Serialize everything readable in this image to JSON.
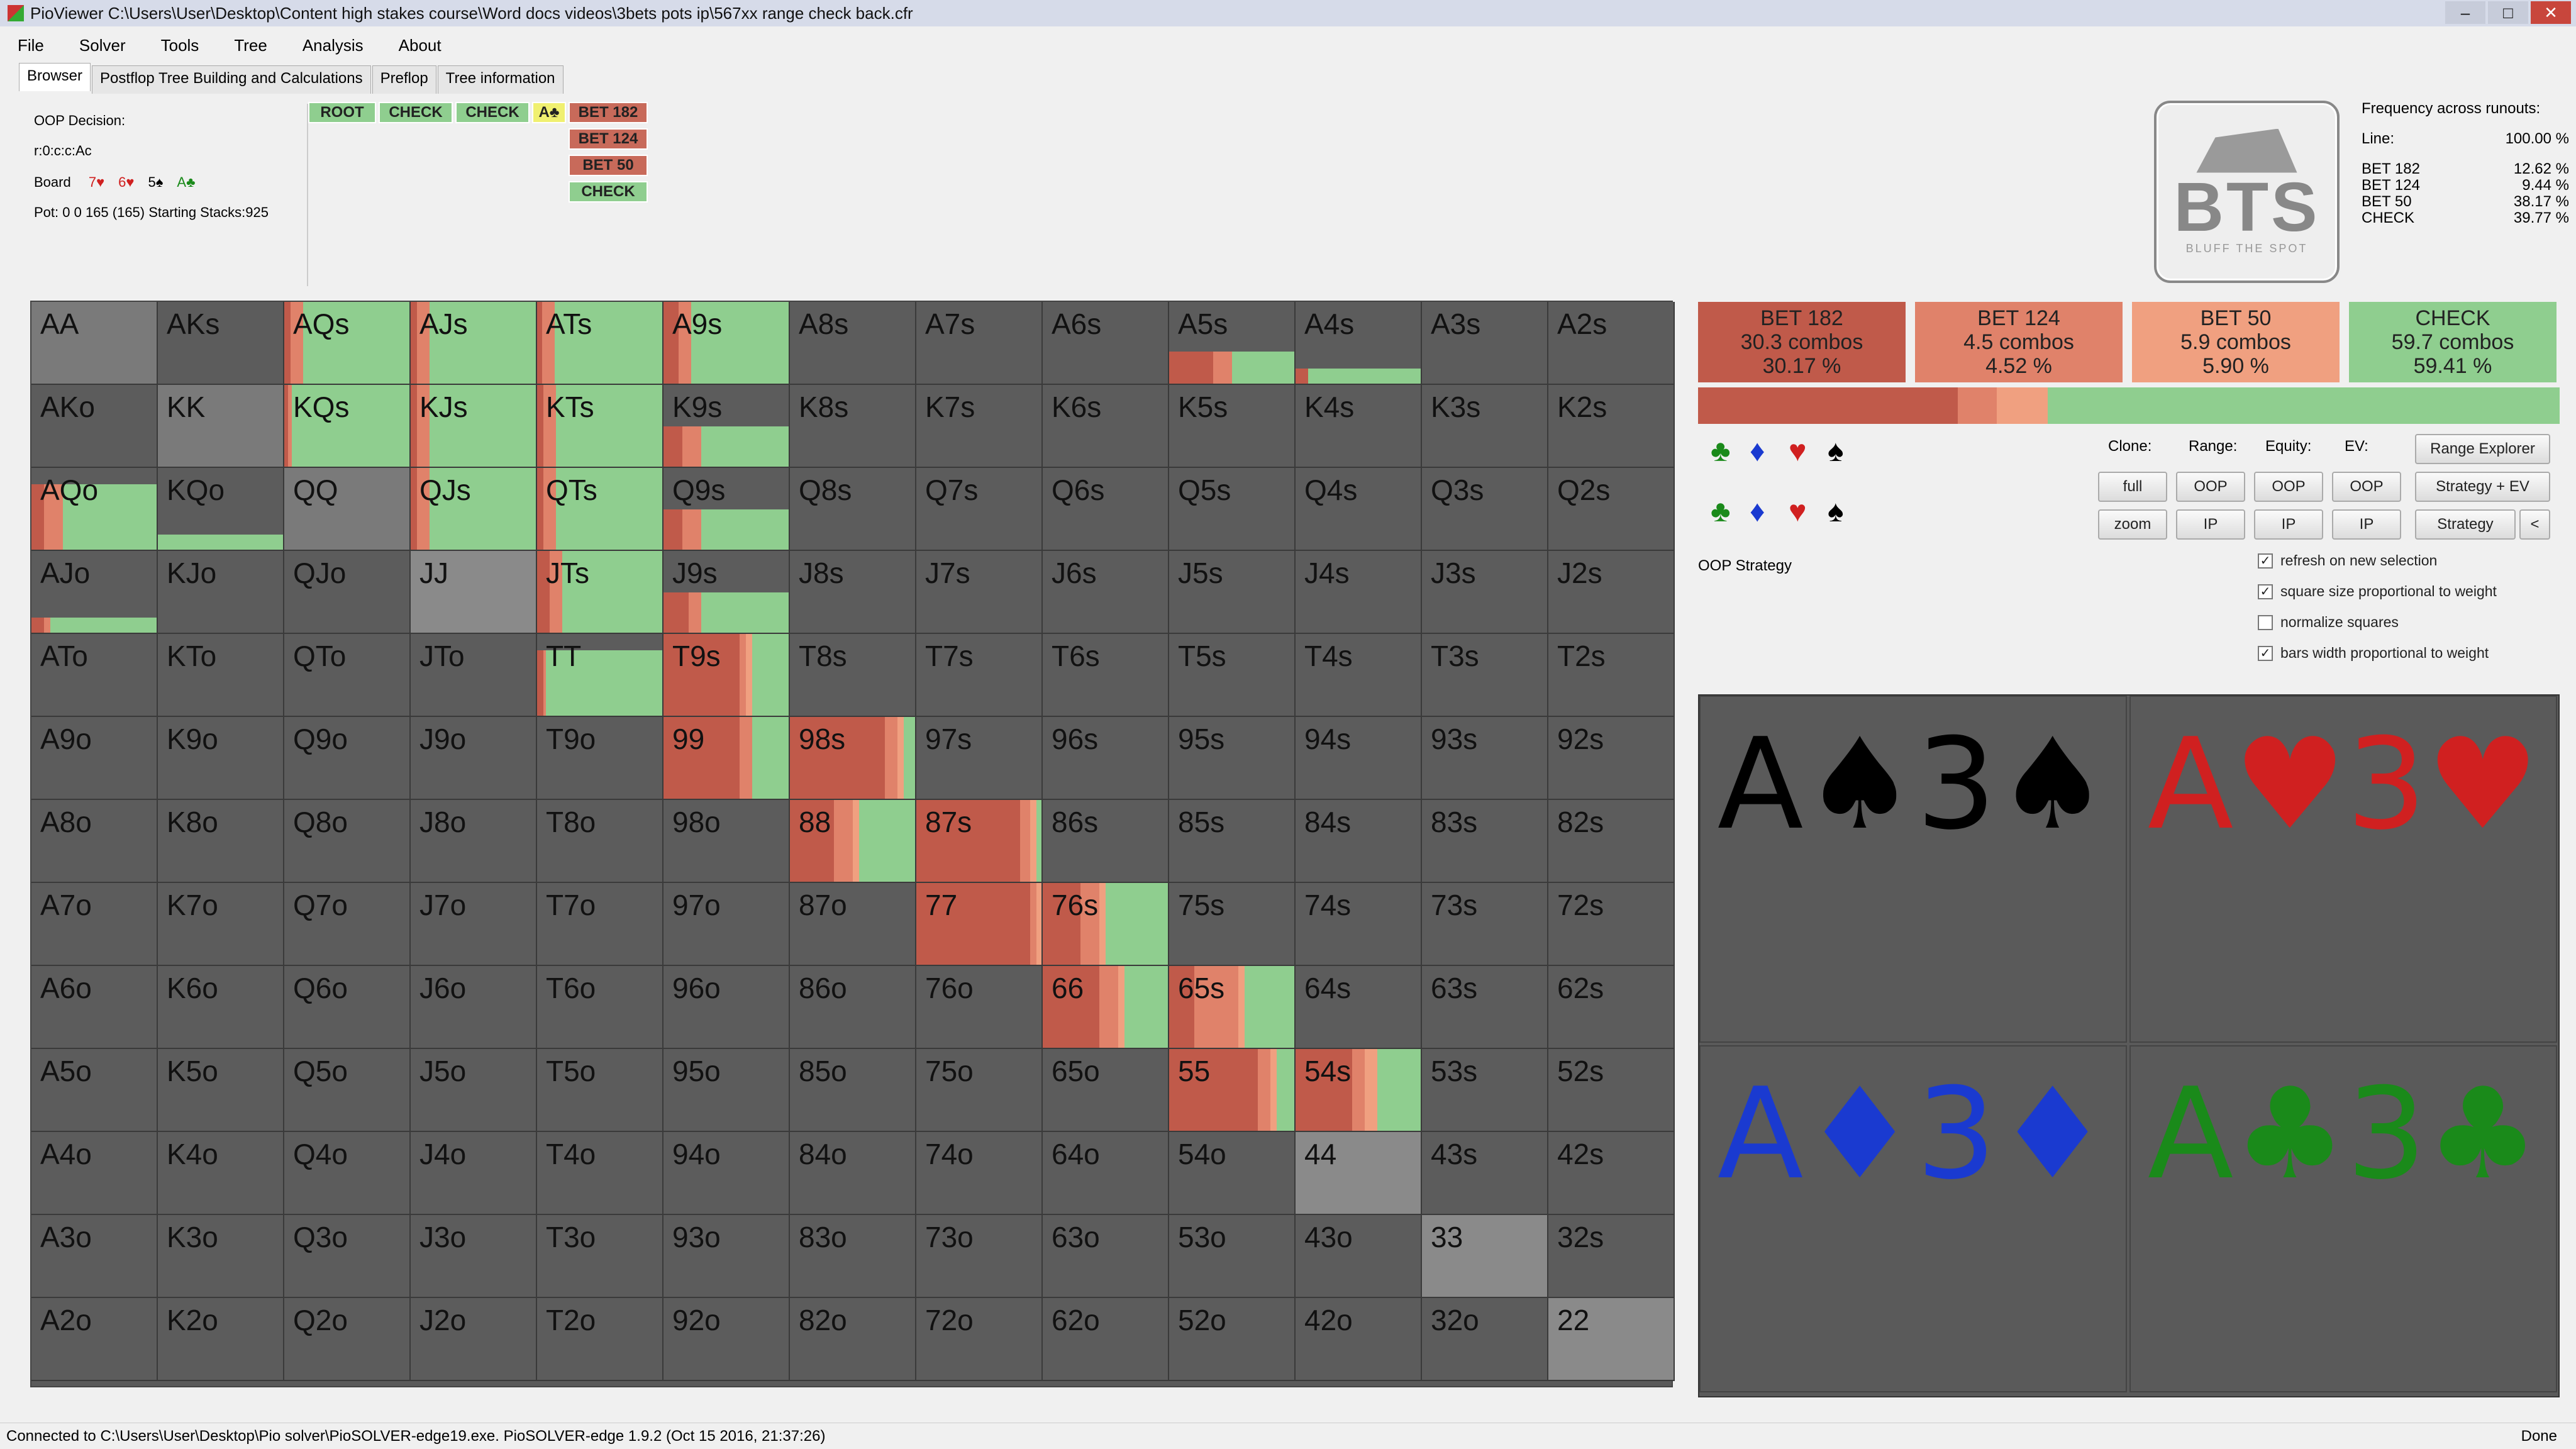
{
  "window": {
    "title": "PioViewer C:\\Users\\User\\Desktop\\Content high stakes course\\Word docs videos\\3bets pots ip\\567xx range check back.cfr"
  },
  "menu": [
    "File",
    "Solver",
    "Tools",
    "Tree",
    "Analysis",
    "About"
  ],
  "tabs": [
    "Browser",
    "Postflop Tree Building and Calculations",
    "Preflop",
    "Tree information"
  ],
  "info": {
    "decision": "OOP Decision:",
    "line": "r:0:c:c:Ac",
    "board_label": "Board",
    "board_cards": [
      {
        "text": "7♥",
        "color": "redc"
      },
      {
        "text": "6♥",
        "color": "redc"
      },
      {
        "text": "5♠",
        "color": "blkc"
      },
      {
        "text": "A♣",
        "color": "grnc"
      }
    ],
    "pot": "Pot: 0 0 165 (165) Starting Stacks:925"
  },
  "crumbs": {
    "row": [
      {
        "label": "ROOT",
        "style": "green"
      },
      {
        "label": "CHECK",
        "style": "green"
      },
      {
        "label": "CHECK",
        "style": "green"
      },
      {
        "label": "A♣",
        "style": "yellow"
      },
      {
        "label": "BET 182",
        "style": "red"
      }
    ],
    "column": [
      {
        "label": "BET 124",
        "style": "red"
      },
      {
        "label": "BET 50",
        "style": "red"
      },
      {
        "label": "CHECK",
        "style": "green"
      }
    ]
  },
  "logo": {
    "text": "BTS",
    "tagline": "BLUFF THE SPOT"
  },
  "freq": {
    "title": "Frequency across runouts:",
    "line_label": "Line:",
    "line_value": "100.00 %",
    "rows": [
      {
        "label": "BET 182",
        "value": "12.62 %"
      },
      {
        "label": "BET 124",
        "value": "9.44 %"
      },
      {
        "label": "BET 50",
        "value": "38.17 %"
      },
      {
        "label": "CHECK",
        "value": "39.77 %"
      }
    ]
  },
  "actions": [
    {
      "name": "BET 182",
      "combos": "30.3 combos",
      "pct": "30.17 %",
      "color": "#c05a4a"
    },
    {
      "name": "BET 124",
      "combos": "4.5 combos",
      "pct": "4.52 %",
      "color": "#e0826a"
    },
    {
      "name": "BET 50",
      "combos": "5.9 combos",
      "pct": "5.90 %",
      "color": "#f0a080"
    },
    {
      "name": "CHECK",
      "combos": "59.7 combos",
      "pct": "59.41 %",
      "color": "#8fce8f"
    }
  ],
  "action_fractions": [
    0.3017,
    0.0452,
    0.059,
    0.5941
  ],
  "controls": {
    "headers": [
      "Clone:",
      "Range:",
      "Equity:",
      "EV:"
    ],
    "buttons_row1": [
      "full",
      "OOP",
      "OOP",
      "OOP"
    ],
    "buttons_row2": [
      "zoom",
      "IP",
      "IP",
      "IP"
    ],
    "range_explorer": "Range Explorer",
    "strategy_ev": "Strategy + EV",
    "strategy": "Strategy",
    "arrow": "<",
    "label": "OOP Strategy",
    "checkboxes": [
      {
        "label": "refresh on new selection",
        "checked": true
      },
      {
        "label": "square size proportional to weight",
        "checked": true
      },
      {
        "label": "normalize squares",
        "checked": false
      },
      {
        "label": "bars width proportional to weight",
        "checked": true
      }
    ],
    "suits_row1": [
      {
        "s": "♣",
        "c": "#1a8a1a"
      },
      {
        "s": "♦",
        "c": "#1a3ad0"
      },
      {
        "s": "♥",
        "c": "#d02020"
      },
      {
        "s": "♠",
        "c": "#000"
      }
    ],
    "suits_row2": [
      {
        "s": "♣",
        "c": "#1a8a1a"
      },
      {
        "s": "♦",
        "c": "#1a3ad0"
      },
      {
        "s": "♥",
        "c": "#d02020"
      },
      {
        "s": "♠",
        "c": "#000"
      }
    ]
  },
  "boards": [
    {
      "text": "A♠3♠",
      "color": "#000"
    },
    {
      "text": "A♥3♥",
      "color": "#d02020"
    },
    {
      "text": "A♦3♦",
      "color": "#1a3ad0"
    },
    {
      "text": "A♣3♣",
      "color": "#1a8a1a"
    }
  ],
  "status": {
    "left": "Connected to C:\\Users\\User\\Desktop\\Pio solver\\PioSOLVER-edge19.exe. PioSOLVER-edge 1.9.2 (Oct 15 2016, 21:37:26)",
    "right": "Done"
  },
  "grid": {
    "labels": [
      [
        "AA",
        "AKs",
        "AQs",
        "AJs",
        "ATs",
        "A9s",
        "A8s",
        "A7s",
        "A6s",
        "A5s",
        "A4s",
        "A3s",
        "A2s"
      ],
      [
        "AKo",
        "KK",
        "KQs",
        "KJs",
        "KTs",
        "K9s",
        "K8s",
        "K7s",
        "K6s",
        "K5s",
        "K4s",
        "K3s",
        "K2s"
      ],
      [
        "AQo",
        "KQo",
        "QQ",
        "QJs",
        "QTs",
        "Q9s",
        "Q8s",
        "Q7s",
        "Q6s",
        "Q5s",
        "Q4s",
        "Q3s",
        "Q2s"
      ],
      [
        "AJo",
        "KJo",
        "QJo",
        "JJ",
        "JTs",
        "J9s",
        "J8s",
        "J7s",
        "J6s",
        "J5s",
        "J4s",
        "J3s",
        "J2s"
      ],
      [
        "ATo",
        "KTo",
        "QTo",
        "JTo",
        "TT",
        "T9s",
        "T8s",
        "T7s",
        "T6s",
        "T5s",
        "T4s",
        "T3s",
        "T2s"
      ],
      [
        "A9o",
        "K9o",
        "Q9o",
        "J9o",
        "T9o",
        "99",
        "98s",
        "97s",
        "96s",
        "95s",
        "94s",
        "93s",
        "92s"
      ],
      [
        "A8o",
        "K8o",
        "Q8o",
        "J8o",
        "T8o",
        "98o",
        "88",
        "87s",
        "86s",
        "85s",
        "84s",
        "83s",
        "82s"
      ],
      [
        "A7o",
        "K7o",
        "Q7o",
        "J7o",
        "T7o",
        "97o",
        "87o",
        "77",
        "76s",
        "75s",
        "74s",
        "73s",
        "72s"
      ],
      [
        "A6o",
        "K6o",
        "Q6o",
        "J6o",
        "T6o",
        "96o",
        "86o",
        "76o",
        "66",
        "65s",
        "64s",
        "63s",
        "62s"
      ],
      [
        "A5o",
        "K5o",
        "Q5o",
        "J5o",
        "T5o",
        "95o",
        "85o",
        "75o",
        "65o",
        "55",
        "54s",
        "53s",
        "52s"
      ],
      [
        "A4o",
        "K4o",
        "Q4o",
        "J4o",
        "T4o",
        "94o",
        "84o",
        "74o",
        "64o",
        "54o",
        "44",
        "43s",
        "42s"
      ],
      [
        "A3o",
        "K3o",
        "Q3o",
        "J3o",
        "T3o",
        "93o",
        "83o",
        "73o",
        "63o",
        "53o",
        "43o",
        "33",
        "32s"
      ],
      [
        "A2o",
        "K2o",
        "Q2o",
        "J2o",
        "T2o",
        "92o",
        "82o",
        "72o",
        "62o",
        "52o",
        "42o",
        "32o",
        "22"
      ]
    ],
    "strategies": {
      "0,0": {
        "weight": 1.0,
        "mix": [],
        "bg": "#7a7a7a"
      },
      "0,2": {
        "weight": 1.0,
        "mix": [
          0.05,
          0.1,
          0,
          0.85
        ]
      },
      "0,3": {
        "weight": 1.0,
        "mix": [
          0.05,
          0.1,
          0,
          0.85
        ]
      },
      "0,4": {
        "weight": 1.0,
        "mix": [
          0.04,
          0.1,
          0,
          0.86
        ]
      },
      "0,5": {
        "weight": 1.0,
        "mix": [
          0.12,
          0.1,
          0,
          0.78
        ]
      },
      "0,9": {
        "weight": 0.4,
        "mix": [
          0.35,
          0.15,
          0,
          0.5
        ]
      },
      "0,10": {
        "weight": 0.2,
        "mix": [
          0.1,
          0,
          0,
          0.9
        ]
      },
      "1,1": {
        "weight": 1.0,
        "mix": [],
        "bg": "#7a7a7a"
      },
      "1,2": {
        "weight": 1.0,
        "mix": [
          0.03,
          0.03,
          0,
          0.94
        ]
      },
      "1,3": {
        "weight": 1.0,
        "mix": [
          0.05,
          0.1,
          0,
          0.85
        ]
      },
      "1,4": {
        "weight": 1.0,
        "mix": [
          0.05,
          0.1,
          0,
          0.85
        ]
      },
      "1,5": {
        "weight": 0.5,
        "mix": [
          0.15,
          0.15,
          0,
          0.7
        ]
      },
      "2,0": {
        "weight": 0.8,
        "mix": [
          0.1,
          0.15,
          0,
          0.75
        ]
      },
      "2,1": {
        "weight": 0.2,
        "mix": [
          0,
          0,
          0,
          1
        ]
      },
      "2,2": {
        "weight": 1.0,
        "mix": [],
        "bg": "#7a7a7a"
      },
      "2,3": {
        "weight": 1.0,
        "mix": [
          0.05,
          0.1,
          0,
          0.85
        ]
      },
      "2,4": {
        "weight": 1.0,
        "mix": [
          0.05,
          0.1,
          0,
          0.85
        ]
      },
      "2,5": {
        "weight": 0.5,
        "mix": [
          0.15,
          0.15,
          0,
          0.7
        ]
      },
      "3,0": {
        "weight": 0.2,
        "mix": [
          0.1,
          0.05,
          0,
          0.85
        ]
      },
      "3,3": {
        "weight": 1.0,
        "mix": [],
        "bg": "#8a8a8a"
      },
      "3,4": {
        "weight": 1.0,
        "mix": [
          0.1,
          0.1,
          0,
          0.8
        ]
      },
      "3,5": {
        "weight": 0.5,
        "mix": [
          0.2,
          0.1,
          0,
          0.7
        ]
      },
      "4,4": {
        "weight": 0.8,
        "mix": [
          0.05,
          0.02,
          0,
          0.93
        ]
      },
      "4,5": {
        "weight": 1.0,
        "mix": [
          0.6,
          0.05,
          0.05,
          0.3
        ]
      },
      "5,5": {
        "weight": 1.0,
        "mix": [
          0.6,
          0.1,
          0,
          0.3
        ]
      },
      "5,6": {
        "weight": 1.0,
        "mix": [
          0.75,
          0.1,
          0.05,
          0.1
        ]
      },
      "6,6": {
        "weight": 1.0,
        "mix": [
          0.35,
          0.15,
          0.05,
          0.45
        ]
      },
      "6,7": {
        "weight": 1.0,
        "mix": [
          0.82,
          0.08,
          0.05,
          0.05
        ]
      },
      "7,7": {
        "weight": 1.0,
        "mix": [
          0.9,
          0.05,
          0.05,
          0
        ]
      },
      "7,8": {
        "weight": 1.0,
        "mix": [
          0.3,
          0.15,
          0.05,
          0.5
        ]
      },
      "8,8": {
        "weight": 1.0,
        "mix": [
          0.45,
          0.15,
          0.05,
          0.35
        ]
      },
      "8,9": {
        "weight": 1.0,
        "mix": [
          0.2,
          0.35,
          0.05,
          0.4
        ]
      },
      "9,9": {
        "weight": 1.0,
        "mix": [
          0.7,
          0.1,
          0.05,
          0.15
        ]
      },
      "9,10": {
        "weight": 1.0,
        "mix": [
          0.45,
          0.1,
          0.1,
          0.35
        ]
      },
      "10,10": {
        "weight": 1.0,
        "mix": [],
        "bg": "#8a8a8a"
      },
      "11,11": {
        "weight": 1.0,
        "mix": [],
        "bg": "#8a8a8a"
      },
      "12,12": {
        "weight": 1.0,
        "mix": [],
        "bg": "#8a8a8a"
      }
    }
  }
}
